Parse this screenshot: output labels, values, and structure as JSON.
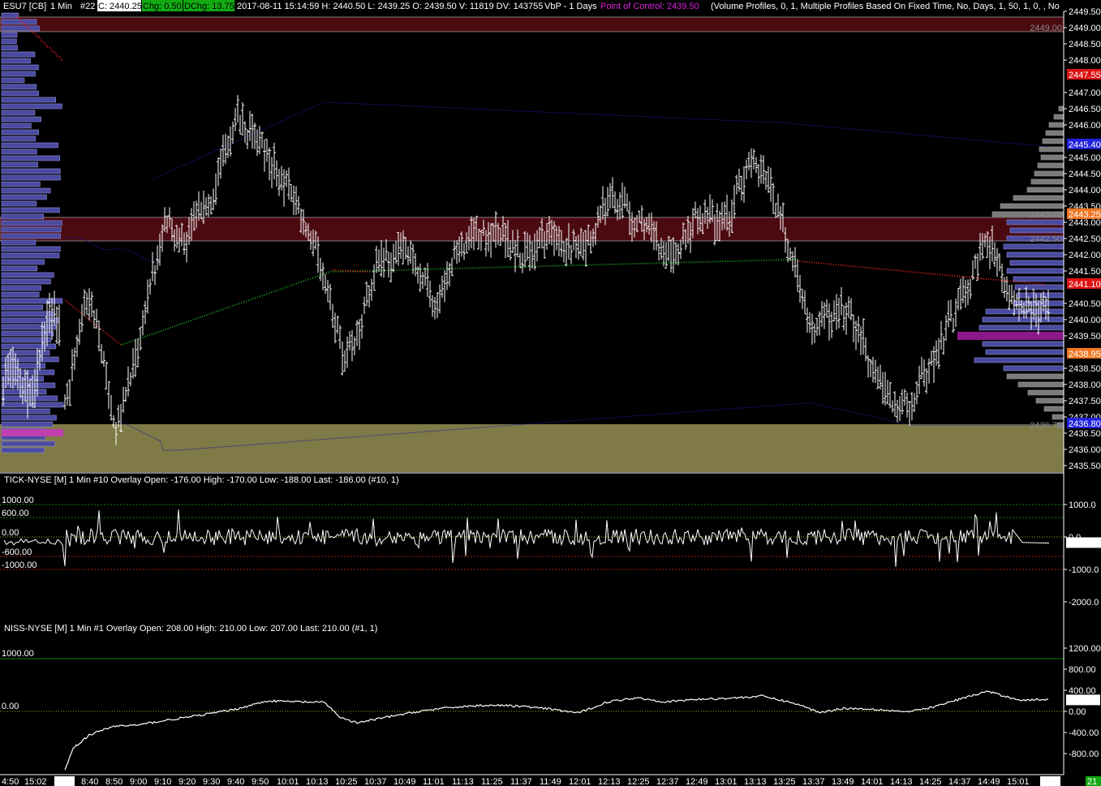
{
  "header": {
    "symbol": "ESU7 [CB]",
    "interval": "1 Min",
    "chart_no": "#22",
    "close": "C: 2440.25",
    "chg": "Chg: 0.50",
    "dchg": "DChg: 13.75",
    "bar_info": "2017-08-11 15:14:59 H: 2440.50 L: 2439.25 O: 2439.50 V: 11819 DV: 143755",
    "vbp": "VbP - 1 Days",
    "poc": "Point of Control: 2439.50",
    "study": "(Volume Profiles, 0, 1, Multiple Profiles Based On Fixed Time, No, Days, 1, 50, 1, 0, , No"
  },
  "colors": {
    "background": "#000000",
    "price_bar": "#ffffff",
    "profile": "#4a4aa0",
    "profile_dark": "#7a7a7a",
    "poc_bar": "#8a1a8a",
    "resistance_zone": "#4a0a10",
    "support_zone": "#7f7a46",
    "vwap_green": "#22aa22",
    "vwap_red": "#dd2222",
    "band_blue": "#1a1aa0"
  },
  "price_axis": {
    "labels": [
      "2449.50",
      "2449.00",
      "2448.50",
      "2448.00",
      "2447.55",
      "2447.00",
      "2446.50",
      "2446.00",
      "2445.40",
      "2445.00",
      "2444.50",
      "2444.00",
      "2443.50",
      "2443.25",
      "2443.00",
      "2442.50",
      "2442.00",
      "2441.50",
      "2441.10",
      "2441.00",
      "2440.50",
      "2440.00",
      "2439.50",
      "2438.95",
      "2438.50",
      "2438.00",
      "2437.50",
      "2437.00",
      "2436.50",
      "2436.00",
      "2435.50"
    ],
    "badges": [
      {
        "label": "2447.55",
        "value": 2447.55,
        "color": "#dd1111"
      },
      {
        "label": "2445.40",
        "value": 2445.4,
        "color": "#2222dd"
      },
      {
        "label": "2443.25",
        "value": 2443.25,
        "color": "#ee7722"
      },
      {
        "label": "2441.10",
        "value": 2441.1,
        "color": "#dd1111"
      },
      {
        "label": "2438.95",
        "value": 2438.95,
        "color": "#ee7722"
      },
      {
        "label": "2436.80",
        "value": 2436.8,
        "color": "#2222dd"
      }
    ],
    "gray_labels": [
      {
        "label": "2449.00",
        "value": 2449.0
      },
      {
        "label": "2443.25",
        "value": 2443.25
      },
      {
        "label": "2442.50",
        "value": 2442.5
      },
      {
        "label": "2436.75",
        "value": 2436.75
      }
    ]
  },
  "time_axis": [
    "4:50",
    "15:02",
    "8-11",
    "8:40",
    "8:50",
    "9:00",
    "9:10",
    "9:20",
    "9:30",
    "9:40",
    "9:50",
    "10:01",
    "10:13",
    "10:25",
    "10:37",
    "10:49",
    "11:01",
    "11:13",
    "11:25",
    "11:37",
    "11:49",
    "12:01",
    "12:13",
    "12:25",
    "12:37",
    "12:49",
    "13:01",
    "13:13",
    "13:25",
    "13:37",
    "13:49",
    "14:01",
    "14:13",
    "14:25",
    "14:37",
    "14:49",
    "15:01",
    "8-12",
    "21"
  ],
  "tick_panel": {
    "title": "TICK-NYSE [M]  1 Min  #10 Overlay  Open: -176.00  High: -170.00  Low: -188.00  Last: -186.00  (#10, 1)",
    "left_levels": [
      {
        "label": "1000.00",
        "value": 1000,
        "color": "#22aa22"
      },
      {
        "label": "600.00",
        "value": 600,
        "color": "#22aa22"
      },
      {
        "label": "0.00",
        "value": 0,
        "color": "#dddd22"
      },
      {
        "label": "-600.00",
        "value": -600,
        "color": "#dd2222"
      },
      {
        "label": "-1000.00",
        "value": -1000,
        "color": "#dd2222"
      }
    ],
    "right_labels": [
      "1000.0",
      "0.0",
      "-1000.0",
      "-2000.0"
    ],
    "last_badge": "-186.00"
  },
  "niss_panel": {
    "title": "NISS-NYSE [M]  1 Min  #1 Overlay  Open: 208.00  High: 210.00  Low: 207.00  Last: 210.00  (#1, 1)",
    "left_levels": [
      {
        "label": "1000.00",
        "value": 1000,
        "color": "#22aa22"
      },
      {
        "label": "0.00",
        "value": 0,
        "color": "#dddd22"
      }
    ],
    "right_labels": [
      "1200.00",
      "800.00",
      "400.00",
      "0.00",
      "-400.00",
      "-800.00"
    ],
    "last_badge": "210.00"
  },
  "chart_data": {
    "type": "candlestick",
    "symbol": "ESU7",
    "interval": "1 Min",
    "date": "2017-08-11",
    "ylim": [
      2435.25,
      2449.75
    ],
    "resistance_zone": [
      2448.95,
      2449.5
    ],
    "value_area_zone": [
      2442.5,
      2443.25
    ],
    "support_zone": [
      2435.25,
      2436.75
    ],
    "point_of_control": 2439.5,
    "price_path": [
      [
        "8-11",
        2437.5
      ],
      [
        "8:40",
        2441.0
      ],
      [
        "8:50",
        2436.5
      ],
      [
        "9:00",
        2439.0
      ],
      [
        "9:10",
        2443.0
      ],
      [
        "9:20",
        2442.5
      ],
      [
        "9:30",
        2444.0
      ],
      [
        "9:40",
        2446.2
      ],
      [
        "9:50",
        2445.5
      ],
      [
        "10:01",
        2444.0
      ],
      [
        "10:13",
        2442.5
      ],
      [
        "10:25",
        2438.5
      ],
      [
        "10:37",
        2441.5
      ],
      [
        "10:49",
        2442.5
      ],
      [
        "11:01",
        2440.5
      ],
      [
        "11:13",
        2442.5
      ],
      [
        "11:25",
        2442.5
      ],
      [
        "11:37",
        2442.0
      ],
      [
        "11:49",
        2442.5
      ],
      [
        "12:01",
        2442.0
      ],
      [
        "12:13",
        2443.8
      ],
      [
        "12:25",
        2443.0
      ],
      [
        "12:37",
        2442.0
      ],
      [
        "12:49",
        2443.0
      ],
      [
        "13:01",
        2443.0
      ],
      [
        "13:13",
        2445.2
      ],
      [
        "13:25",
        2443.0
      ],
      [
        "13:37",
        2439.5
      ],
      [
        "13:49",
        2440.5
      ],
      [
        "14:01",
        2438.5
      ],
      [
        "14:13",
        2437.0
      ],
      [
        "14:25",
        2438.5
      ],
      [
        "14:37",
        2440.5
      ],
      [
        "14:49",
        2442.5
      ],
      [
        "15:01",
        2440.25
      ]
    ]
  }
}
